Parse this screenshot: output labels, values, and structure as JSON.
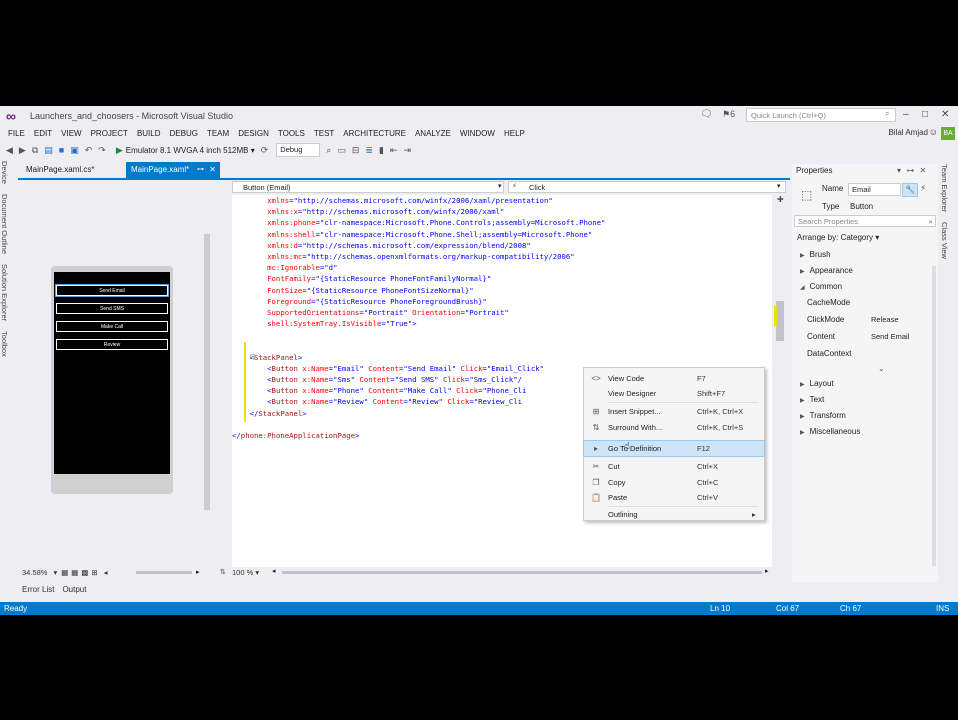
{
  "window": {
    "title": "Launchers_and_choosers - Microsoft Visual Studio",
    "notification_count": "6"
  },
  "quick_launch": {
    "placeholder": "Quick Launch (Ctrl+Q)"
  },
  "menu": [
    "FILE",
    "EDIT",
    "VIEW",
    "PROJECT",
    "BUILD",
    "DEBUG",
    "TEAM",
    "DESIGN",
    "TOOLS",
    "TEST",
    "ARCHITECTURE",
    "ANALYZE",
    "WINDOW",
    "HELP"
  ],
  "user": {
    "name": "Bilal Amjad",
    "initials": "BA"
  },
  "toolbar": {
    "run_target": "Emulator 8.1 WVGA 4 inch 512MB",
    "config": "Debug"
  },
  "left_tabs": [
    "Device",
    "Document Outline",
    "Solution Explorer",
    "Toolbox"
  ],
  "right_tabs": [
    "Team Explorer",
    "Class View"
  ],
  "doc_tabs": [
    {
      "label": "MainPage.xaml.cs*"
    },
    {
      "label": "MainPage.xaml*"
    }
  ],
  "designer": {
    "phone_buttons": [
      "Send Email",
      "Send SMS",
      "Make Call",
      "Review"
    ],
    "zoom": "34.58%"
  },
  "editor": {
    "nav_left": "Button (Email)",
    "nav_right": "Click",
    "zoom": "100 %",
    "code_lines": [
      [
        {
          "c": "at",
          "t": "        xmlns"
        },
        {
          "c": "br",
          "t": "="
        },
        {
          "c": "av",
          "t": "\"http://schemas.microsoft.com/winfx/2006/xaml/presentation\""
        }
      ],
      [
        {
          "c": "at",
          "t": "        xmlns:x"
        },
        {
          "c": "br",
          "t": "="
        },
        {
          "c": "av",
          "t": "\"http://schemas.microsoft.com/winfx/2006/xaml\""
        }
      ],
      [
        {
          "c": "at",
          "t": "        xmlns:phone"
        },
        {
          "c": "br",
          "t": "="
        },
        {
          "c": "av",
          "t": "\"clr-namespace:Microsoft.Phone.Controls;assembly=Microsoft.Phone\""
        }
      ],
      [
        {
          "c": "at",
          "t": "        xmlns:shell"
        },
        {
          "c": "br",
          "t": "="
        },
        {
          "c": "av",
          "t": "\"clr-namespace:Microsoft.Phone.Shell;assembly=Microsoft.Phone\""
        }
      ],
      [
        {
          "c": "at",
          "t": "        xmlns:d"
        },
        {
          "c": "br",
          "t": "="
        },
        {
          "c": "av",
          "t": "\"http://schemas.microsoft.com/expression/blend/2008\""
        }
      ],
      [
        {
          "c": "at",
          "t": "        xmlns:mc"
        },
        {
          "c": "br",
          "t": "="
        },
        {
          "c": "av",
          "t": "\"http://schemas.openxmlformats.org/markup-compatibility/2006\""
        }
      ],
      [
        {
          "c": "at",
          "t": "        mc:Ignorable"
        },
        {
          "c": "br",
          "t": "="
        },
        {
          "c": "av",
          "t": "\"d\""
        }
      ],
      [
        {
          "c": "at",
          "t": "        FontFamily"
        },
        {
          "c": "br",
          "t": "="
        },
        {
          "c": "av",
          "t": "\"{StaticResource PhoneFontFamilyNormal}\""
        }
      ],
      [
        {
          "c": "at",
          "t": "        FontSize"
        },
        {
          "c": "br",
          "t": "="
        },
        {
          "c": "av",
          "t": "\"{StaticResource PhoneFontSizeNormal}\""
        }
      ],
      [
        {
          "c": "at",
          "t": "        Foreground"
        },
        {
          "c": "br",
          "t": "="
        },
        {
          "c": "av",
          "t": "\"{StaticResource PhoneForegroundBrush}\""
        }
      ],
      [
        {
          "c": "at",
          "t": "        SupportedOrientations"
        },
        {
          "c": "br",
          "t": "="
        },
        {
          "c": "av",
          "t": "\"Portrait\""
        },
        {
          "c": "at",
          "t": " Orientation"
        },
        {
          "c": "br",
          "t": "="
        },
        {
          "c": "av",
          "t": "\"Portrait\""
        }
      ],
      [
        {
          "c": "at",
          "t": "        shell:SystemTray.IsVisible"
        },
        {
          "c": "br",
          "t": "="
        },
        {
          "c": "av",
          "t": "\"True\""
        },
        {
          "c": "br",
          "t": ">"
        }
      ],
      [],
      [],
      [
        {
          "c": "br",
          "t": "    <"
        },
        {
          "c": "tg",
          "t": "StackPanel"
        },
        {
          "c": "br",
          "t": ">"
        }
      ],
      [
        {
          "c": "br",
          "t": "        <"
        },
        {
          "c": "tg",
          "t": "Button"
        },
        {
          "c": "at",
          "t": " x:Name"
        },
        {
          "c": "br",
          "t": "="
        },
        {
          "c": "av",
          "t": "\"Email\""
        },
        {
          "c": "at",
          "t": " Content"
        },
        {
          "c": "br",
          "t": "="
        },
        {
          "c": "av",
          "t": "\"Send Email\""
        },
        {
          "c": "at",
          "t": " Click"
        },
        {
          "c": "br",
          "t": "="
        },
        {
          "c": "av",
          "t": "\"Email_Click\""
        }
      ],
      [
        {
          "c": "br",
          "t": "        <"
        },
        {
          "c": "tg",
          "t": "Button"
        },
        {
          "c": "at",
          "t": " x:Name"
        },
        {
          "c": "br",
          "t": "="
        },
        {
          "c": "av",
          "t": "\"Sms\""
        },
        {
          "c": "at",
          "t": " Content"
        },
        {
          "c": "br",
          "t": "="
        },
        {
          "c": "av",
          "t": "\"Send SMS\""
        },
        {
          "c": "at",
          "t": " Click"
        },
        {
          "c": "br",
          "t": "="
        },
        {
          "c": "av",
          "t": "\"Sms_Click\""
        },
        {
          "c": "br",
          "t": "/"
        }
      ],
      [
        {
          "c": "br",
          "t": "        <"
        },
        {
          "c": "tg",
          "t": "Button"
        },
        {
          "c": "at",
          "t": " x:Name"
        },
        {
          "c": "br",
          "t": "="
        },
        {
          "c": "av",
          "t": "\"Phone\""
        },
        {
          "c": "at",
          "t": " Content"
        },
        {
          "c": "br",
          "t": "="
        },
        {
          "c": "av",
          "t": "\"Make Call\""
        },
        {
          "c": "at",
          "t": " Click"
        },
        {
          "c": "br",
          "t": "="
        },
        {
          "c": "av",
          "t": "\"Phone_Cli"
        }
      ],
      [
        {
          "c": "br",
          "t": "        <"
        },
        {
          "c": "tg",
          "t": "Button"
        },
        {
          "c": "at",
          "t": " x:Name"
        },
        {
          "c": "br",
          "t": "="
        },
        {
          "c": "av",
          "t": "\"Review\""
        },
        {
          "c": "at",
          "t": " Content"
        },
        {
          "c": "br",
          "t": "="
        },
        {
          "c": "av",
          "t": "\"Review\""
        },
        {
          "c": "at",
          "t": " Click"
        },
        {
          "c": "br",
          "t": "="
        },
        {
          "c": "av",
          "t": "\"Review_Cli"
        }
      ],
      [
        {
          "c": "br",
          "t": "    </"
        },
        {
          "c": "tg",
          "t": "StackPanel"
        },
        {
          "c": "br",
          "t": ">"
        }
      ],
      [],
      [
        {
          "c": "br",
          "t": "</"
        },
        {
          "c": "tg",
          "t": "phone:PhoneApplicationPage"
        },
        {
          "c": "br",
          "t": ">"
        }
      ]
    ]
  },
  "context_menu": {
    "items": [
      {
        "icon": "<>",
        "label": "View Code",
        "shortcut": "F7"
      },
      {
        "icon": "",
        "label": "View Designer",
        "shortcut": "Shift+F7"
      },
      {
        "icon": "⊞",
        "label": "Insert Snippet...",
        "shortcut": "Ctrl+K, Ctrl+X"
      },
      {
        "icon": "⇅",
        "label": "Surround With...",
        "shortcut": "Ctrl+K, Ctrl+S"
      },
      {
        "icon": "▸",
        "label": "Go To Definition",
        "shortcut": "F12",
        "highlight": true
      },
      {
        "icon": "✂",
        "label": "Cut",
        "shortcut": "Ctrl+X"
      },
      {
        "icon": "❐",
        "label": "Copy",
        "shortcut": "Ctrl+C"
      },
      {
        "icon": "📋",
        "label": "Paste",
        "shortcut": "Ctrl+V"
      },
      {
        "icon": "",
        "label": "Outlining",
        "shortcut": "▸"
      }
    ]
  },
  "bottom_tabs": [
    "Error List",
    "Output"
  ],
  "status": {
    "state": "Ready",
    "line": "Ln 10",
    "col": "Col 67",
    "ch": "Ch 67",
    "mode": "INS"
  },
  "properties": {
    "title": "Properties",
    "name_label": "Name",
    "name_value": "Email",
    "type_label": "Type",
    "type_value": "Button",
    "search_placeholder": "Search Properties",
    "arrange_by": "Arrange by: Category ▾",
    "categories_top": [
      "Brush",
      "Appearance",
      "Common"
    ],
    "common_props": [
      {
        "name": "CacheMode",
        "value": ""
      },
      {
        "name": "ClickMode",
        "value": "Release"
      },
      {
        "name": "Content",
        "value": "Send Email"
      },
      {
        "name": "DataContext",
        "value": ""
      }
    ],
    "categories_bottom": [
      "Layout",
      "Text",
      "Transform",
      "Miscellaneous"
    ]
  }
}
